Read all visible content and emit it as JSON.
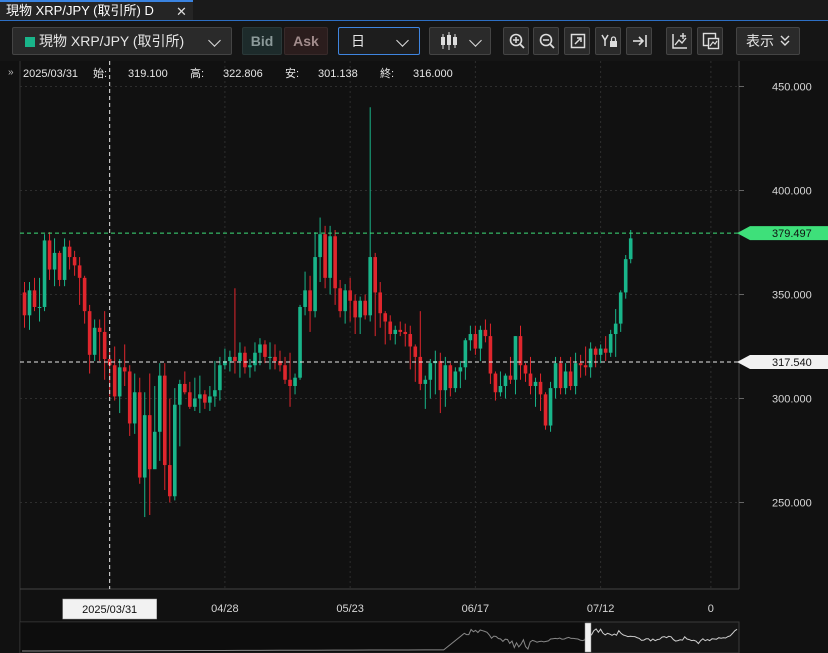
{
  "tab": {
    "title": "現物 XRP/JPY (取引所) D",
    "close": "✕"
  },
  "toolbar": {
    "symbol": "現物 XRP/JPY (取引所)",
    "bid": "Bid",
    "ask": "Ask",
    "period": "日",
    "display": "表示",
    "accent": "#3f85e0",
    "icons": [
      "candlestick-icon",
      "zoom-in-icon",
      "zoom-out-icon",
      "fit-icon",
      "y-lock-icon",
      "scroll-end-icon",
      "add-indicator-icon",
      "compare-icon"
    ]
  },
  "ohlc": {
    "date": "2025/03/31",
    "open_label": "始:",
    "open": "319.100",
    "high_label": "高:",
    "high": "322.806",
    "low_label": "安:",
    "low": "301.138",
    "close_label": "終:",
    "close": "316.000"
  },
  "chart_data": {
    "type": "candlestick",
    "y_ticks": [
      250,
      300,
      350,
      400,
      450
    ],
    "y_tick_labels": [
      "250.000",
      "300.000",
      "350.000",
      "400.000",
      "450.000"
    ],
    "x_tick_labels": [
      {
        "label": "04/28",
        "index": 40
      },
      {
        "label": "05/23",
        "index": 65
      },
      {
        "label": "06/17",
        "index": 90
      },
      {
        "label": "07/12",
        "index": 115
      },
      {
        "label": "0",
        "index": 137
      }
    ],
    "crosshair_label": "2025/03/31",
    "crosshair_index": 17,
    "current_price": {
      "value": 379.497,
      "label": "379.497",
      "color": "#3ee07a"
    },
    "crosshair_price": {
      "value": 317.54,
      "label": "317.540"
    },
    "up_color": "#19b58a",
    "down_color": "#e0262d",
    "grid": true,
    "candles": [
      [
        351,
        356,
        334,
        340
      ],
      [
        340,
        356,
        333,
        352
      ],
      [
        352,
        358,
        342,
        344
      ],
      [
        344,
        358,
        337,
        344
      ],
      [
        344,
        379,
        342,
        376
      ],
      [
        376,
        380,
        357,
        362
      ],
      [
        362,
        377,
        354,
        370
      ],
      [
        370,
        371,
        354,
        357
      ],
      [
        357,
        377,
        354,
        373
      ],
      [
        373,
        376,
        362,
        368
      ],
      [
        368,
        371,
        359,
        364
      ],
      [
        364,
        368,
        345,
        358
      ],
      [
        358,
        359,
        336,
        342
      ],
      [
        342,
        345,
        312,
        321
      ],
      [
        321,
        338,
        318,
        334
      ],
      [
        334,
        338,
        318,
        332
      ],
      [
        332,
        342,
        309,
        319
      ],
      [
        319,
        323,
        301,
        316
      ],
      [
        316,
        325,
        299,
        301
      ],
      [
        301,
        319,
        293,
        315
      ],
      [
        315,
        326,
        306,
        313
      ],
      [
        313,
        316,
        282,
        288
      ],
      [
        288,
        312,
        283,
        303
      ],
      [
        303,
        310,
        259,
        262
      ],
      [
        262,
        303,
        243,
        292
      ],
      [
        292,
        312,
        244,
        266
      ],
      [
        266,
        306,
        282,
        284
      ],
      [
        284,
        317,
        270,
        311
      ],
      [
        311,
        317,
        256,
        268
      ],
      [
        268,
        300,
        250,
        253
      ],
      [
        253,
        305,
        251,
        297
      ],
      [
        297,
        309,
        277,
        307
      ],
      [
        307,
        313,
        302,
        303
      ],
      [
        303,
        308,
        295,
        296
      ],
      [
        296,
        310,
        294,
        300
      ],
      [
        300,
        311,
        293,
        302
      ],
      [
        302,
        304,
        295,
        298
      ],
      [
        298,
        306,
        294,
        301
      ],
      [
        301,
        318,
        296,
        304
      ],
      [
        304,
        320,
        299,
        316
      ],
      [
        316,
        324,
        314,
        318
      ],
      [
        318,
        323,
        313,
        320
      ],
      [
        320,
        353,
        312,
        318
      ],
      [
        318,
        327,
        310,
        322
      ],
      [
        322,
        325,
        312,
        315
      ],
      [
        315,
        319,
        310,
        316
      ],
      [
        316,
        327,
        313,
        322
      ],
      [
        322,
        329,
        316,
        326
      ],
      [
        326,
        328,
        317,
        320
      ],
      [
        320,
        327,
        314,
        320
      ],
      [
        320,
        326,
        314,
        318
      ],
      [
        318,
        323,
        313,
        316
      ],
      [
        316,
        320,
        307,
        309
      ],
      [
        309,
        322,
        296,
        306
      ],
      [
        306,
        312,
        302,
        310
      ],
      [
        310,
        345,
        309,
        344
      ],
      [
        344,
        361,
        340,
        352
      ],
      [
        352,
        359,
        332,
        342
      ],
      [
        342,
        380,
        339,
        368
      ],
      [
        368,
        387,
        356,
        379
      ],
      [
        379,
        383,
        353,
        358
      ],
      [
        358,
        383,
        350,
        378
      ],
      [
        378,
        381,
        345,
        353
      ],
      [
        353,
        357,
        339,
        342
      ],
      [
        342,
        355,
        336,
        352
      ],
      [
        352,
        358,
        337,
        347
      ],
      [
        347,
        350,
        331,
        339
      ],
      [
        339,
        349,
        331,
        347
      ],
      [
        347,
        350,
        338,
        340
      ],
      [
        340,
        440,
        337,
        368
      ],
      [
        368,
        370,
        330,
        351
      ],
      [
        351,
        356,
        334,
        341
      ],
      [
        341,
        342,
        326,
        337
      ],
      [
        337,
        340,
        328,
        331
      ],
      [
        331,
        335,
        326,
        333
      ],
      [
        333,
        337,
        330,
        332
      ],
      [
        332,
        336,
        325,
        331
      ],
      [
        331,
        335,
        314,
        325
      ],
      [
        325,
        326,
        308,
        320
      ],
      [
        320,
        342,
        304,
        307
      ],
      [
        307,
        311,
        295,
        309
      ],
      [
        309,
        319,
        300,
        317
      ],
      [
        317,
        323,
        302,
        318
      ],
      [
        318,
        322,
        293,
        304
      ],
      [
        304,
        320,
        296,
        316
      ],
      [
        316,
        317,
        301,
        305
      ],
      [
        305,
        315,
        303,
        313
      ],
      [
        313,
        318,
        305,
        315
      ],
      [
        315,
        329,
        309,
        328
      ],
      [
        328,
        335,
        323,
        331
      ],
      [
        331,
        335,
        321,
        324
      ],
      [
        324,
        335,
        318,
        333
      ],
      [
        333,
        338,
        327,
        330
      ],
      [
        330,
        336,
        307,
        312
      ],
      [
        312,
        313,
        299,
        303
      ],
      [
        303,
        313,
        301,
        306
      ],
      [
        306,
        312,
        300,
        311
      ],
      [
        311,
        320,
        307,
        309
      ],
      [
        309,
        330,
        302,
        330
      ],
      [
        330,
        335,
        309,
        316
      ],
      [
        316,
        317,
        308,
        312
      ],
      [
        312,
        320,
        302,
        306
      ],
      [
        306,
        310,
        296,
        308
      ],
      [
        308,
        312,
        294,
        302
      ],
      [
        302,
        303,
        285,
        287
      ],
      [
        287,
        308,
        284,
        305
      ],
      [
        305,
        320,
        300,
        317
      ],
      [
        317,
        320,
        302,
        305
      ],
      [
        305,
        317,
        302,
        313
      ],
      [
        313,
        320,
        304,
        306
      ],
      [
        306,
        322,
        302,
        317
      ],
      [
        317,
        321,
        310,
        316
      ],
      [
        316,
        325,
        311,
        315
      ],
      [
        315,
        327,
        310,
        324
      ],
      [
        324,
        325,
        315,
        321
      ],
      [
        321,
        326,
        317,
        324
      ],
      [
        324,
        330,
        318,
        322
      ],
      [
        322,
        333,
        320,
        331
      ],
      [
        331,
        343,
        320,
        336
      ],
      [
        336,
        352,
        332,
        351
      ],
      [
        351,
        369,
        348,
        367
      ],
      [
        367,
        381,
        365,
        377
      ]
    ]
  }
}
